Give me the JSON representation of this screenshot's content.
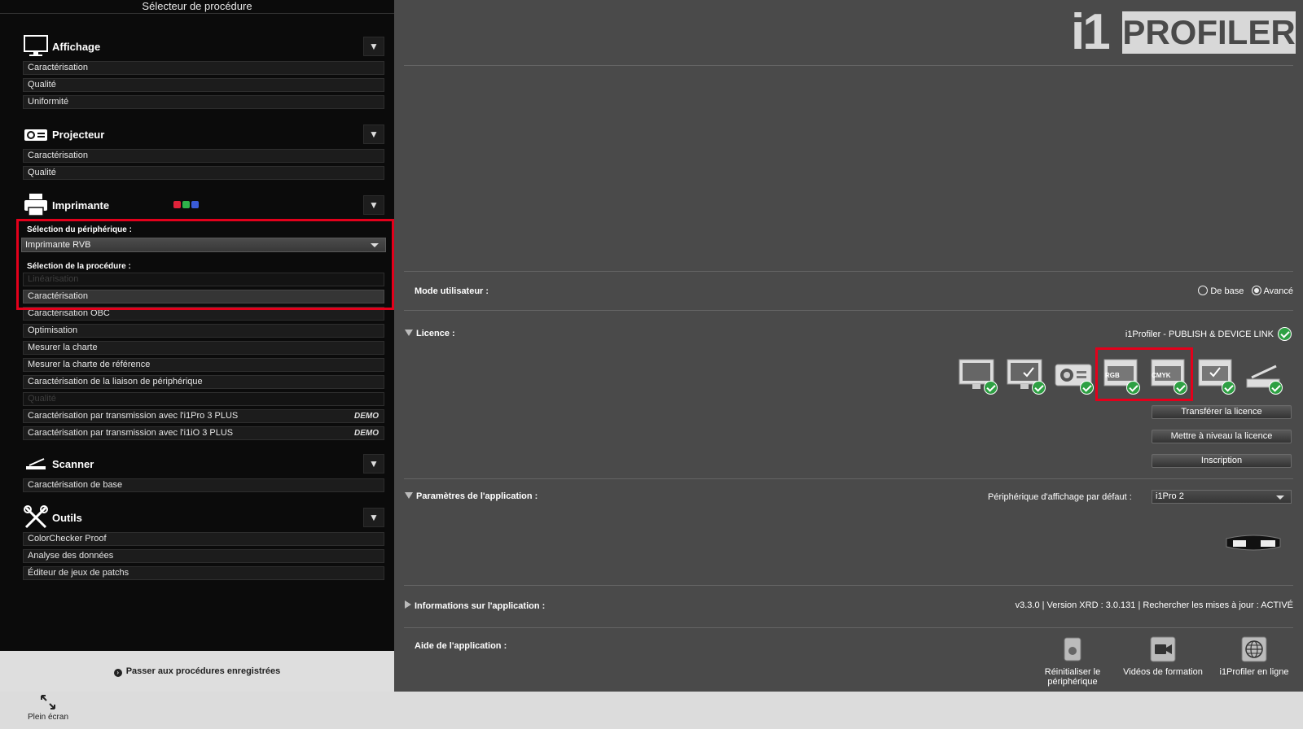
{
  "left": {
    "title": "Sélecteur de procédure",
    "categories": [
      {
        "label": "Affichage",
        "icon": "monitor-icon",
        "items": [
          "Caractérisation",
          "Qualité",
          "Uniformité"
        ]
      },
      {
        "label": "Projecteur",
        "icon": "projector-icon",
        "items": [
          "Caractérisation",
          "Qualité"
        ]
      },
      {
        "label": "Imprimante",
        "icon": "printer-icon",
        "items": [
          "Linéarisation",
          "Caractérisation",
          "Caractérisation OBC",
          "Optimisation",
          "Mesurer la charte",
          "Mesurer la charte de référence",
          "Caractérisation de la liaison de périphérique",
          "Qualité",
          "Caractérisation par transmission avec l'i1Pro 3 PLUS",
          "Caractérisation par transmission avec l'i1iO 3 PLUS"
        ]
      },
      {
        "label": "Scanner",
        "icon": "scanner-icon",
        "items": [
          "Caractérisation de base"
        ]
      },
      {
        "label": "Outils",
        "icon": "tools-icon",
        "items": [
          "ColorChecker Proof",
          "Analyse des données",
          "Éditeur de jeux de patchs"
        ]
      }
    ],
    "printer": {
      "device_label": "Sélection du périphérique :",
      "device_value": "Imprimante RVB",
      "procedure_label": "Sélection de la procédure :",
      "demo_badge": "DEMO",
      "ink_colors": [
        "#e0233a",
        "#2fb34a",
        "#3a5bd8"
      ]
    },
    "footer": "Passer aux procédures enregistrées"
  },
  "bottom": {
    "fullscreen": "Plein écran"
  },
  "right": {
    "logo_i1": "i1",
    "logo_profiler": "PROFILER",
    "mode_label": "Mode utilisateur :",
    "mode_basic": "De base",
    "mode_advanced": "Avancé",
    "mode_selected": "Avancé",
    "license_label": "Licence :",
    "license_value": "i1Profiler - PUBLISH & DEVICE LINK",
    "device_tags": {
      "rgb": "RGB",
      "cmyk": "CMYK"
    },
    "btn_transfer": "Transférer la licence",
    "btn_upgrade": "Mettre à niveau la licence",
    "btn_register": "Inscription",
    "params_label": "Paramètres de l'application :",
    "default_device_label": "Périphérique d'affichage par défaut :",
    "default_device_value": "i1Pro 2",
    "info_label": "Informations sur l'application :",
    "info_value": "v3.3.0 | Version XRD : 3.0.131 | Rechercher les mises à jour : ACTIVÉ",
    "help_label": "Aide de l'application :",
    "help_reset": "Réinitialiser le périphérique",
    "help_videos": "Vidéos de formation",
    "help_online": "i1Profiler en ligne"
  },
  "colors": {
    "highlight": "#e3001b",
    "check": "#2ea043"
  }
}
